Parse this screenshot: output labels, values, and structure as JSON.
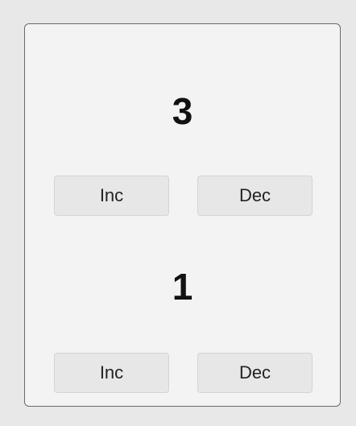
{
  "counters": [
    {
      "value": "3",
      "inc_label": "Inc",
      "dec_label": "Dec"
    },
    {
      "value": "1",
      "inc_label": "Inc",
      "dec_label": "Dec"
    }
  ],
  "colors": {
    "window_bg": "#e8e8e8",
    "panel_bg": "#f3f3f3",
    "panel_border": "#6a6a6a",
    "button_bg": "#e7e7e7",
    "button_border": "#d4d4d4",
    "text": "#111111"
  }
}
